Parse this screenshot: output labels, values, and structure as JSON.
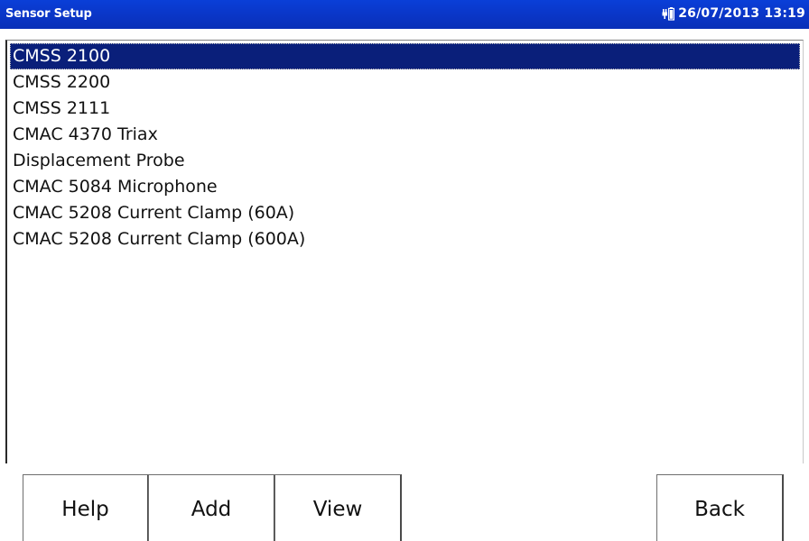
{
  "titlebar": {
    "title": "Sensor Setup",
    "datetime": "26/07/2013 13:19",
    "status_icon": "battery-icon",
    "background": "#0a36c8",
    "text_color": "#ffffff"
  },
  "sensor_list": {
    "selected_index": 0,
    "selection_color": "#0a1f7a",
    "items": [
      {
        "label": "CMSS 2100"
      },
      {
        "label": "CMSS 2200"
      },
      {
        "label": "CMSS 2111"
      },
      {
        "label": "CMAC 4370 Triax"
      },
      {
        "label": "Displacement Probe"
      },
      {
        "label": "CMAC 5084 Microphone"
      },
      {
        "label": "CMAC 5208 Current Clamp (60A)"
      },
      {
        "label": "CMAC 5208 Current Clamp (600A)"
      }
    ]
  },
  "buttons": {
    "help": "Help",
    "add": "Add",
    "view": "View",
    "back": "Back"
  }
}
